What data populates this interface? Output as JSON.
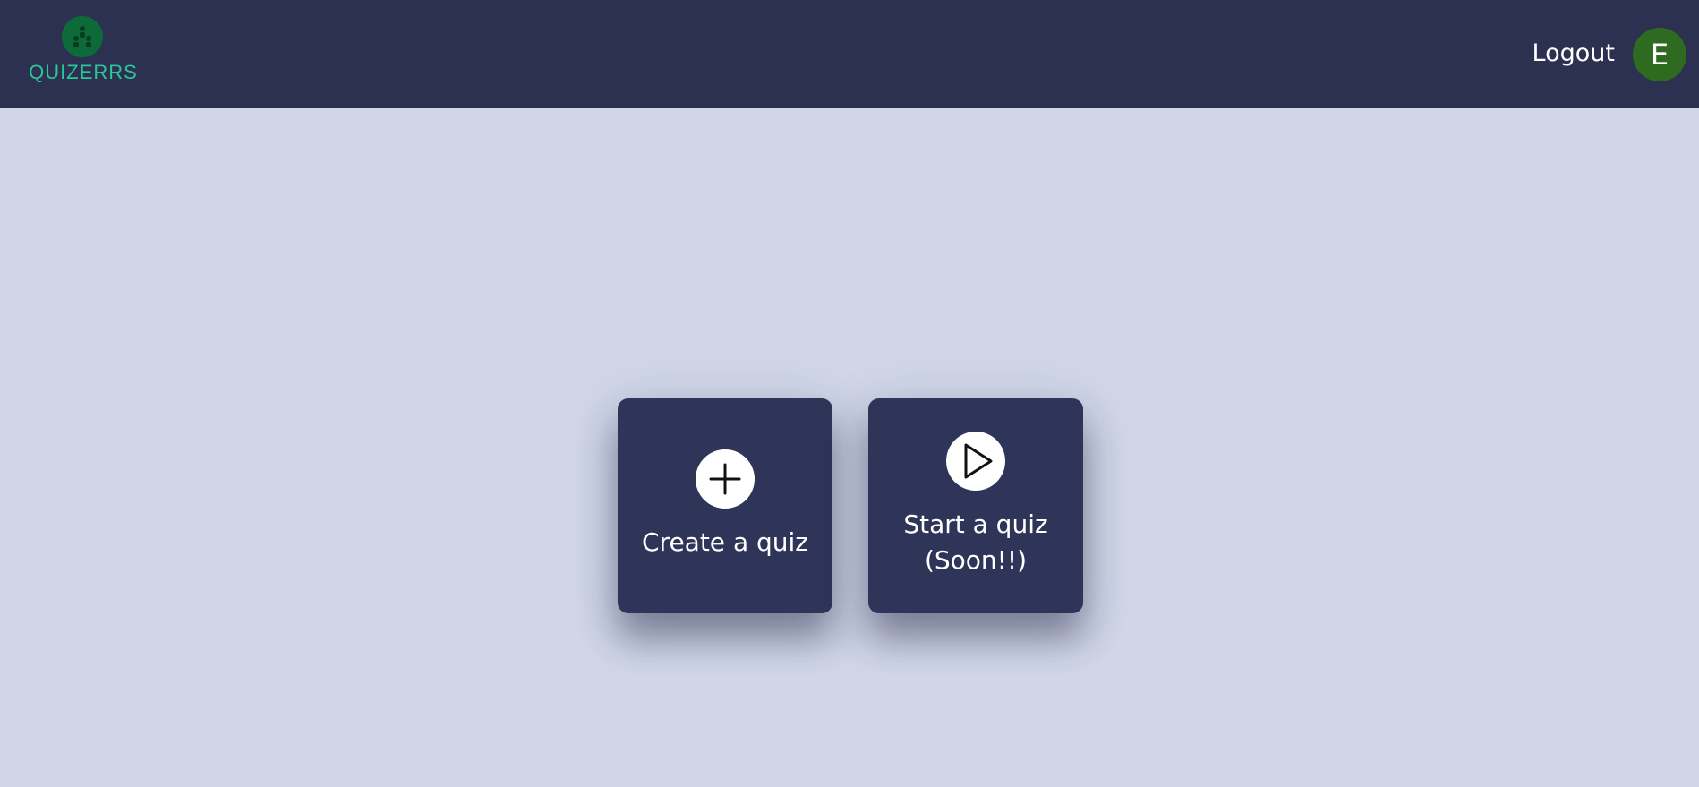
{
  "header": {
    "logo_text": "QUIZERRS",
    "logout_label": "Logout",
    "avatar_initial": "E"
  },
  "cards": {
    "create": {
      "label": "Create a quiz",
      "icon": "plus-icon"
    },
    "start": {
      "label_line1": "Start a quiz",
      "label_line2": "(Soon!!)",
      "icon": "play-icon"
    }
  },
  "colors": {
    "header_bg": "#2d3151",
    "page_bg": "#d0d5e8",
    "card_bg": "#2e3558",
    "logo_text": "#2bc596",
    "logo_badge": "#0d6b3a",
    "avatar_bg": "#2e6a1f"
  }
}
